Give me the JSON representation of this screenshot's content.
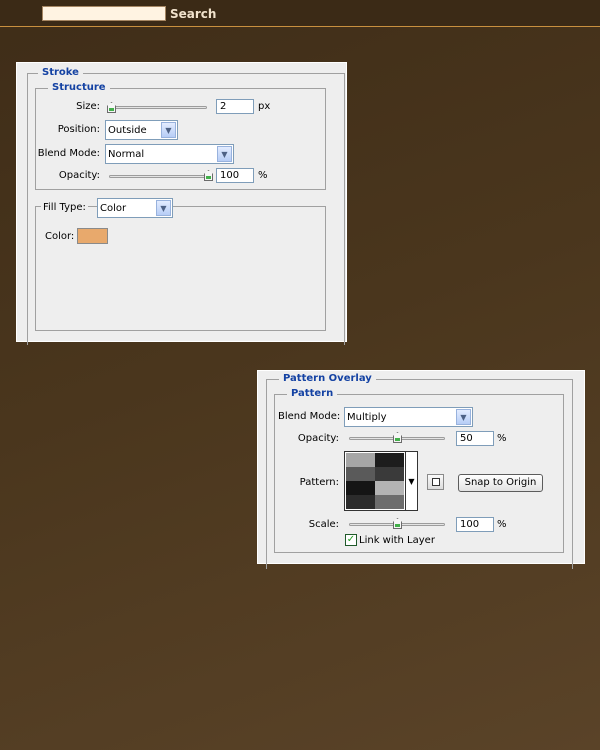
{
  "header": {
    "search_placeholder": "",
    "search_label": "Search"
  },
  "stroke_panel": {
    "title": "Stroke",
    "structure_title": "Structure",
    "size_label": "Size:",
    "size_value": "2",
    "size_unit": "px",
    "position_label": "Position:",
    "position_value": "Outside",
    "blend_mode_label": "Blend Mode:",
    "blend_mode_value": "Normal",
    "opacity_label": "Opacity:",
    "opacity_value": "100",
    "opacity_unit": "%",
    "fill_type_label": "Fill Type:",
    "fill_type_value": "Color",
    "color_label": "Color:",
    "color_swatch": "#e8a96c"
  },
  "pattern_panel": {
    "title": "Pattern Overlay",
    "pattern_title": "Pattern",
    "blend_mode_label": "Blend Mode:",
    "blend_mode_value": "Multiply",
    "opacity_label": "Opacity:",
    "opacity_value": "50",
    "opacity_unit": "%",
    "pattern_label": "Pattern:",
    "snap_button": "Snap to Origin",
    "scale_label": "Scale:",
    "scale_value": "100",
    "scale_unit": "%",
    "link_label": "Link with Layer",
    "link_checked": true,
    "pattern_cells": [
      "#a6a6a6",
      "#1d1d1d",
      "#5a5a5a",
      "#3a3a3a",
      "#151515",
      "#b4b4b4",
      "#2c2c2c",
      "#6d6d6d"
    ]
  }
}
